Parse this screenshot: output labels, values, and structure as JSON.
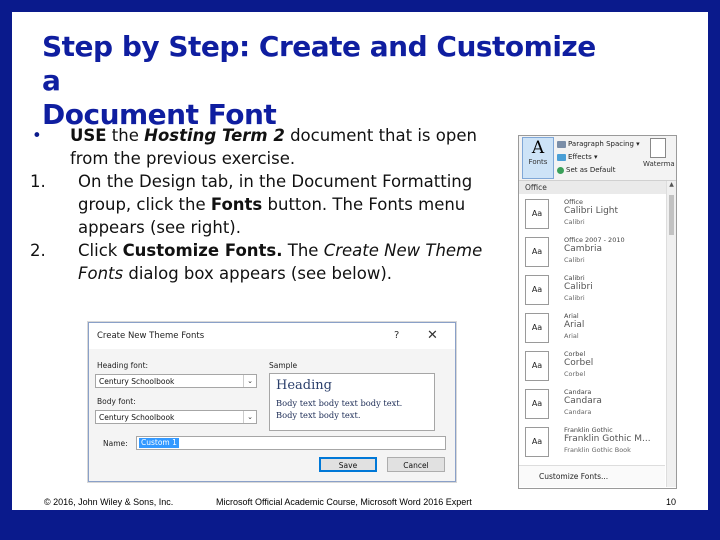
{
  "title": {
    "line1": "Step by Step: Create and Customize a",
    "line2": "Document Font"
  },
  "bullets": [
    {
      "mark": "•",
      "parts": [
        {
          "text": "USE",
          "style": "bold"
        },
        {
          "text": " the ",
          "style": "normal"
        },
        {
          "text": "Hosting Term 2",
          "style": "bold-italic"
        },
        {
          "text": " document that is open from the previous exercise.",
          "style": "normal"
        }
      ]
    },
    {
      "mark": "1.",
      "parts": [
        {
          "text": "On the Design tab, in the Document Formatting group, click the ",
          "style": "normal"
        },
        {
          "text": "Fonts",
          "style": "bold"
        },
        {
          "text": " button. The Fonts menu appears (see right).",
          "style": "normal"
        }
      ]
    },
    {
      "mark": "2.",
      "parts": [
        {
          "text": "Click ",
          "style": "normal"
        },
        {
          "text": "Customize Fonts.",
          "style": "bold"
        },
        {
          "text": " The ",
          "style": "normal"
        },
        {
          "text": "Create New Theme Fonts",
          "style": "italic"
        },
        {
          "text": " dialog box appears (see below).",
          "style": "normal"
        }
      ]
    }
  ],
  "fonts_menu": {
    "fonts_button": "Fonts",
    "fonts_glyph": "A",
    "paragraph_spacing": "Paragraph Spacing",
    "effects": "Effects",
    "set_as_default": "Set as Default",
    "watermark": "Waterma",
    "section_header": "Office",
    "preview_glyph": "Aa",
    "entries": [
      {
        "name": "Office",
        "heading": "Calibri Light",
        "body": "Calibri"
      },
      {
        "name": "Office 2007 - 2010",
        "heading": "Cambria",
        "body": "Calibri"
      },
      {
        "name": "Calibri",
        "heading": "Calibri",
        "body": "Calibri"
      },
      {
        "name": "Arial",
        "heading": "Arial",
        "body": "Arial"
      },
      {
        "name": "Corbel",
        "heading": "Corbel",
        "body": "Corbel"
      },
      {
        "name": "Candara",
        "heading": "Candara",
        "body": "Candara"
      },
      {
        "name": "Franklin Gothic",
        "heading": "Franklin Gothic M...",
        "body": "Franklin Gothic Book"
      }
    ],
    "customize_label": "Customize Fonts..."
  },
  "dialog": {
    "title": "Create New Theme Fonts",
    "help": "?",
    "close": "✕",
    "heading_font_label": "Heading font:",
    "heading_font_value": "Century Schoolbook",
    "body_font_label": "Body font:",
    "body_font_value": "Century Schoolbook",
    "sample_label": "Sample",
    "sample_heading": "Heading",
    "sample_body_line1": "Body text body text body text.",
    "sample_body_line2": "Body text body text.",
    "name_label": "Name:",
    "name_value": "Custom 1",
    "save_label": "Save",
    "cancel_label": "Cancel"
  },
  "footer": {
    "copyright": "© 2016, John Wiley & Sons, Inc.",
    "course": "Microsoft Official Academic Course, Microsoft Word 2016 Expert",
    "page_number": "10"
  }
}
